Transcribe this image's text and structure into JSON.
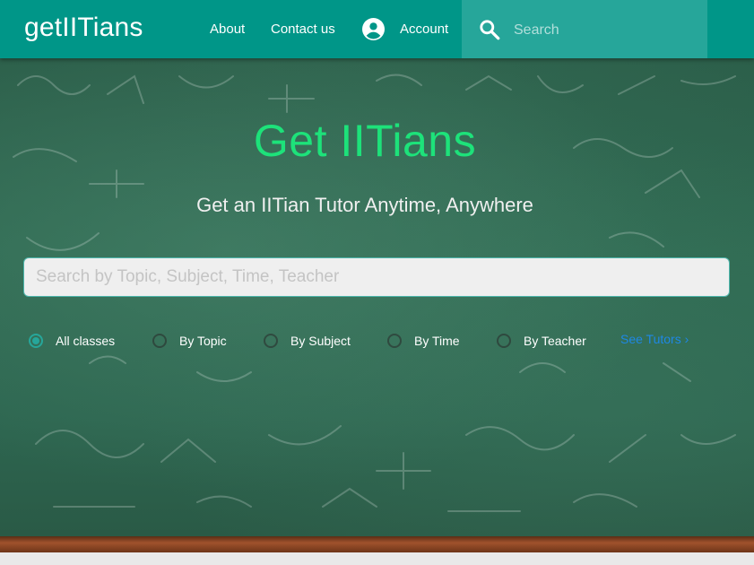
{
  "header": {
    "brand": "getIITians",
    "nav": {
      "about": "About",
      "contact": "Contact us",
      "account": "Account"
    },
    "search_placeholder": "Search"
  },
  "hero": {
    "title": "Get IITians",
    "subtitle": "Get an IITian Tutor Anytime, Anywhere",
    "search_placeholder": "Search by Topic, Subject, Time, Teacher"
  },
  "filters": {
    "options": [
      {
        "label": "All classes",
        "checked": true
      },
      {
        "label": "By Topic",
        "checked": false
      },
      {
        "label": "By Subject",
        "checked": false
      },
      {
        "label": "By Time",
        "checked": false
      },
      {
        "label": "By Teacher",
        "checked": false
      }
    ],
    "see_tutors": "See Tutors"
  },
  "colors": {
    "header": "#009688",
    "search_box": "#26a69a",
    "title": "#1de27a",
    "link": "#1e88e5"
  },
  "icons": [
    "account-circle-icon",
    "search-icon",
    "chevron-right-icon"
  ]
}
